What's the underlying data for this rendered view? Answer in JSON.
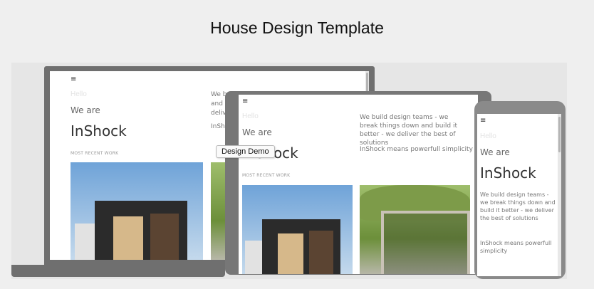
{
  "page": {
    "title": "House Design Template"
  },
  "tooltip": {
    "label": "Design Demo"
  },
  "preview": {
    "menu_icon": "≡",
    "hello": "Hello",
    "we_are": "We are",
    "brand": "InShock",
    "recent_work": "MOST RECENT WORK",
    "desc_1": "We build design teams - we break things down and build it better - we deliver the best of solutions",
    "desc_2": "InShock means powerfull simplicity"
  },
  "laptop_preview": {
    "desc_partial_1": "We b",
    "desc_partial_2": "and b",
    "desc_partial_3": "deliv",
    "desc_partial_4": "InSh"
  },
  "icons": [
    "hamburger-menu-icon"
  ],
  "colors": {
    "device_frame": "#6f6f6f",
    "background": "#efefef"
  }
}
